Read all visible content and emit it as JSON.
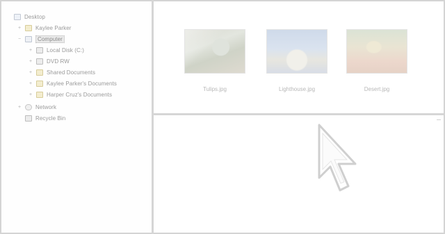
{
  "tree": {
    "items": [
      {
        "label": "Desktop",
        "twisty": "",
        "icon": "desk"
      },
      {
        "label": "Kaylee Parker",
        "twisty": "+",
        "icon": "folder"
      },
      {
        "label": "Computer",
        "twisty": "−",
        "icon": "pc",
        "selected": true
      },
      {
        "label": "Local Disk (C:)",
        "twisty": "+",
        "icon": "drive"
      },
      {
        "label": "DVD RW",
        "twisty": "+",
        "icon": "drive"
      },
      {
        "label": "Shared Documents",
        "twisty": "+",
        "icon": "folder"
      },
      {
        "label": "Kaylee Parker's Documents",
        "twisty": "+",
        "icon": "folder"
      },
      {
        "label": "Harper Cruz's Documents",
        "twisty": "+",
        "icon": "folder"
      },
      {
        "label": "Network",
        "twisty": "+",
        "icon": "net"
      },
      {
        "label": "Recycle Bin",
        "twisty": "",
        "icon": "drive"
      }
    ]
  },
  "thumbnails": [
    {
      "caption": "Tulips.jpg",
      "image": "photo-flowers-thumbnail"
    },
    {
      "caption": "Lighthouse.jpg",
      "image": "photo-lighthouse-thumbnail"
    },
    {
      "caption": "Desert.jpg",
      "image": "photo-desert-thumbnail"
    }
  ],
  "preview": {
    "cursor_icon": "mouse-pointer-arrow-icon"
  }
}
